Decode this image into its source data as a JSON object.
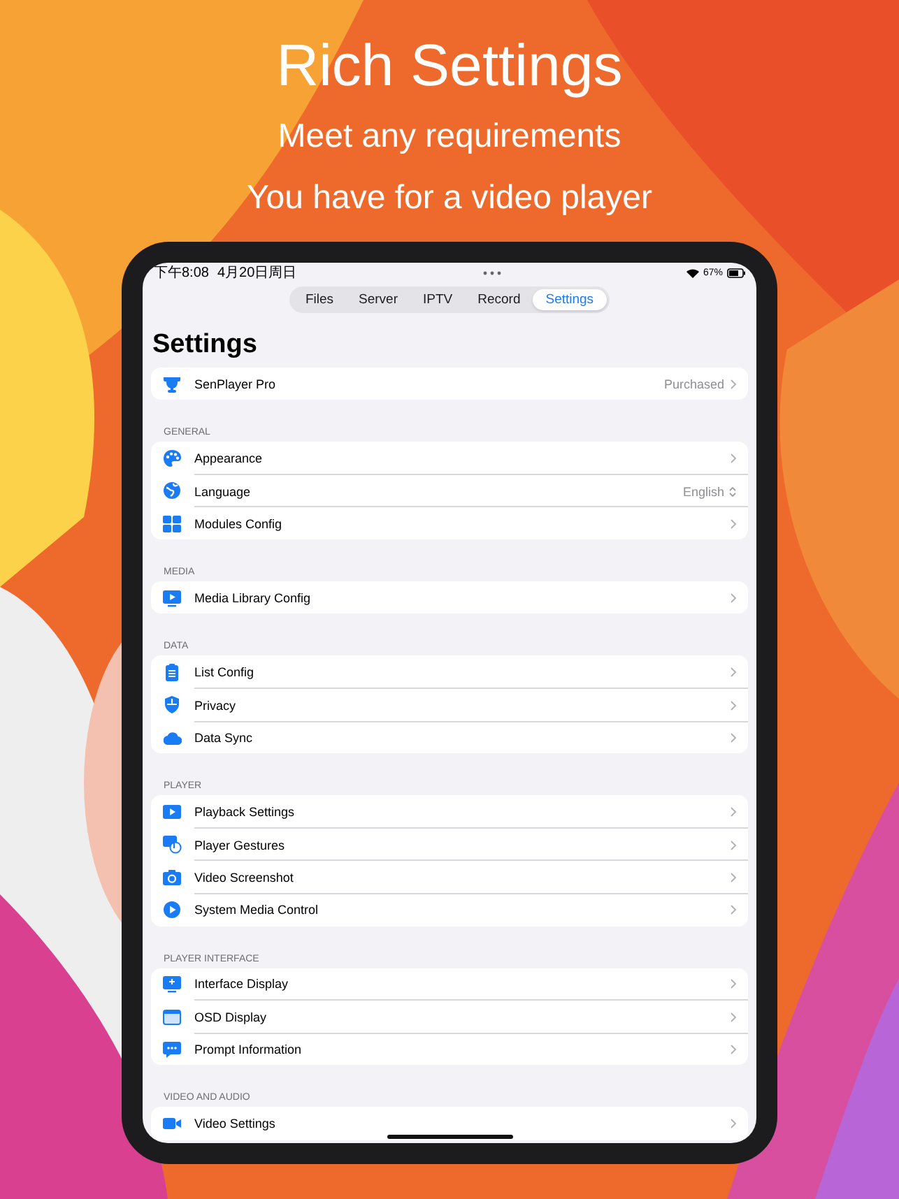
{
  "headline": {
    "title": "Rich Settings",
    "lines": [
      "Meet any requirements",
      "You have for a video player"
    ]
  },
  "status_bar": {
    "time": "下午8:08",
    "date": "4月20日周日",
    "battery_text": "67%"
  },
  "tabs": [
    {
      "label": "Files",
      "selected": false
    },
    {
      "label": "Server",
      "selected": false
    },
    {
      "label": "IPTV",
      "selected": false
    },
    {
      "label": "Record",
      "selected": false
    },
    {
      "label": "Settings",
      "selected": true
    }
  ],
  "page_title": "Settings",
  "sections": [
    {
      "rows": [
        {
          "label": "SenPlayer Pro",
          "value": "Purchased",
          "kind": "link"
        }
      ]
    },
    {
      "header": "GENERAL",
      "rows": [
        {
          "label": "Appearance",
          "kind": "link"
        },
        {
          "label": "Language",
          "value": "English",
          "kind": "picker"
        },
        {
          "label": "Modules Config",
          "kind": "link"
        }
      ]
    },
    {
      "header": "MEDIA",
      "rows": [
        {
          "label": "Media Library Config",
          "kind": "link"
        }
      ]
    },
    {
      "header": "DATA",
      "rows": [
        {
          "label": "List Config",
          "kind": "link"
        },
        {
          "label": "Privacy",
          "kind": "link"
        },
        {
          "label": "Data Sync",
          "kind": "link"
        }
      ]
    },
    {
      "header": "PLAYER",
      "rows": [
        {
          "label": "Playback Settings",
          "kind": "link"
        },
        {
          "label": "Player Gestures",
          "kind": "link"
        },
        {
          "label": "Video Screenshot",
          "kind": "link"
        },
        {
          "label": "System Media Control",
          "kind": "link"
        }
      ]
    },
    {
      "header": "PLAYER INTERFACE",
      "rows": [
        {
          "label": "Interface Display",
          "kind": "link"
        },
        {
          "label": "OSD Display",
          "kind": "link"
        },
        {
          "label": "Prompt Information",
          "kind": "link"
        }
      ]
    },
    {
      "header": "VIDEO AND AUDIO",
      "rows": [
        {
          "label": "Video Settings",
          "kind": "link"
        }
      ]
    }
  ]
}
